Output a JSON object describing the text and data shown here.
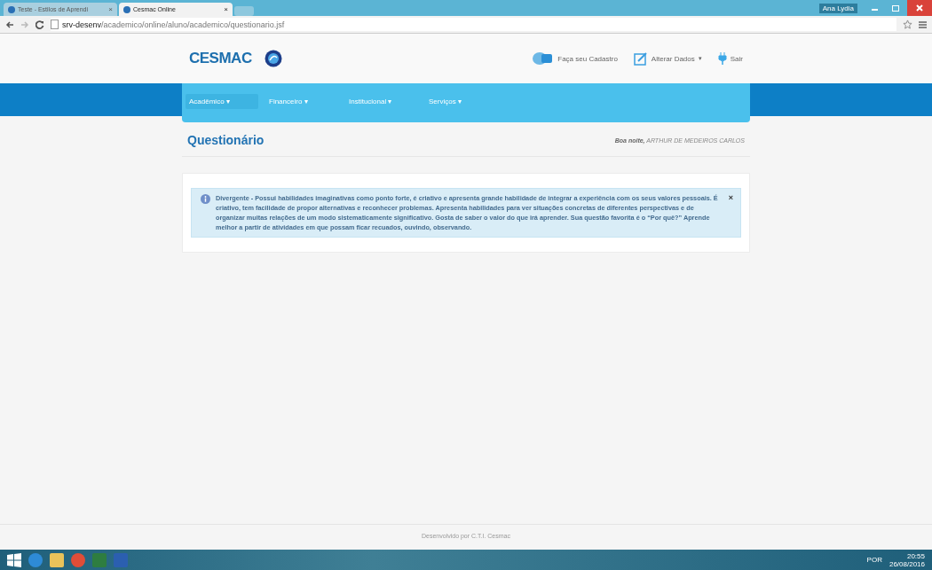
{
  "browser": {
    "tabs": [
      {
        "title": "Teste - Estilos de Aprendi",
        "selected": false
      },
      {
        "title": "Cesmac Online",
        "selected": true
      }
    ],
    "close_glyph": "×",
    "user": "Ana Lydia",
    "url_host": "srv-desenv",
    "url_path": "/academico/online/aluno/academico/questionario.jsf"
  },
  "header": {
    "logo": "CESMAC",
    "links": [
      {
        "kind": "cadastro",
        "label": "Faça seu Cadastro"
      },
      {
        "kind": "alterar",
        "label": "Alterar Dados",
        "caret": "▾"
      },
      {
        "kind": "sair",
        "label": "Sair"
      }
    ]
  },
  "nav": [
    {
      "label": "Acadêmico",
      "selected": true
    },
    {
      "label": "Financeiro",
      "selected": false
    },
    {
      "label": "Institucional",
      "selected": false
    },
    {
      "label": "Serviços",
      "selected": false
    }
  ],
  "nav_caret": "▾",
  "page": {
    "title": "Questionário",
    "greeting": "Boa noite,",
    "user": "ARTHUR DE MEDEIROS CARLOS"
  },
  "alert": {
    "text": "Divergente - Possui habilidades imaginativas como ponto forte, é criativo e apresenta grande habilidade de integrar a experiência com os seus valores pessoais. É criativo, tem facilidade de propor alternativas e reconhecer problemas. Apresenta habilidades para ver situações concretas de diferentes perspectivas e de organizar muitas relações de um modo sistematicamente significativo. Gosta de saber o valor do que irá aprender. Sua questão favorita é o “Por quê?” Aprende melhor a partir de atividades em que possam ficar recuados, ouvindo, observando.",
    "close": "×"
  },
  "footer": "Desenvolvido por C.T.I. Cesmac",
  "taskbar": {
    "lang": "POR",
    "time": "20:55",
    "date": "26/08/2016"
  }
}
